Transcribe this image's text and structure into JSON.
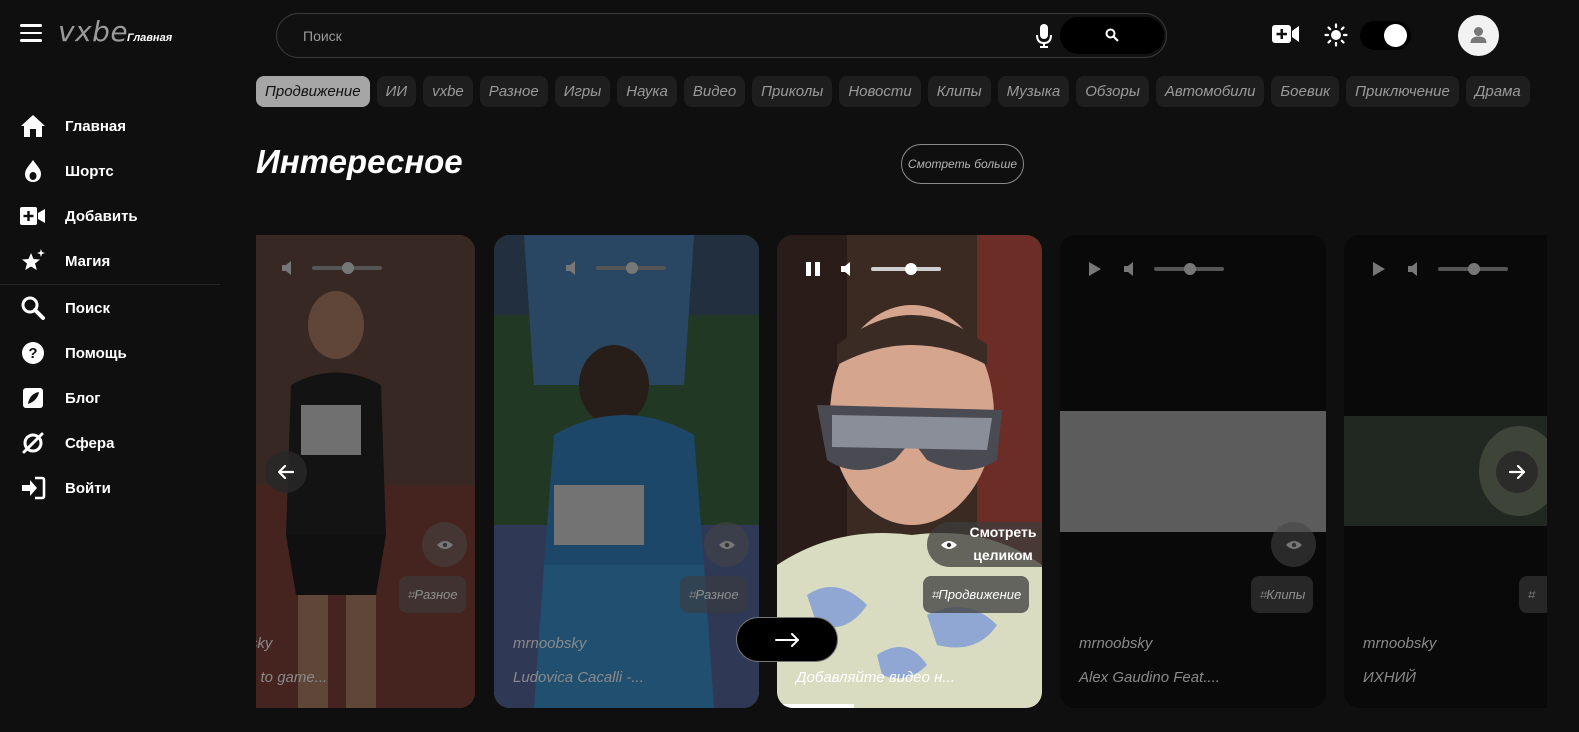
{
  "header": {
    "logo": "vxbe",
    "logo_sub": "Главная",
    "search_placeholder": "Поиск"
  },
  "sidebar": {
    "items": [
      {
        "label": "Главная",
        "icon": "home-icon"
      },
      {
        "label": "Шортс",
        "icon": "flame-icon"
      },
      {
        "label": "Добавить",
        "icon": "add-video-icon"
      },
      {
        "label": "Магия",
        "icon": "magic-star-icon"
      },
      {
        "label": "Поиск",
        "icon": "search-icon"
      },
      {
        "label": "Помощь",
        "icon": "help-icon"
      },
      {
        "label": "Блог",
        "icon": "blog-icon"
      },
      {
        "label": "Сфера",
        "icon": "sphere-icon"
      },
      {
        "label": "Войти",
        "icon": "login-icon"
      }
    ]
  },
  "chips": [
    "Продвижение",
    "ИИ",
    "vxbe",
    "Разное",
    "Игры",
    "Наука",
    "Видео",
    "Приколы",
    "Новости",
    "Клипы",
    "Музыка",
    "Обзоры",
    "Автомобили",
    "Боевик",
    "Приключение",
    "Драма"
  ],
  "active_chip": "Продвижение",
  "section": {
    "title": "Интересное",
    "see_more": "Смотреть больше"
  },
  "cards": [
    {
      "author": "mrnoobsky",
      "caption": "m cutie to game...",
      "tag": "Разное"
    },
    {
      "author": "mrnoobsky",
      "caption": "Ludovica Cacalli -...",
      "tag": "Разное"
    },
    {
      "author": "",
      "caption": "Добавляйте видео н...",
      "tag": "Продвижение",
      "watch_full": "Смотреть целиком"
    },
    {
      "author": "mrnoobsky",
      "caption": "Alex Gaudino Feat....",
      "tag": "Клипы"
    },
    {
      "author": "mrnoobsky",
      "caption": "ИХНИЙ",
      "tag": ""
    }
  ],
  "colors": {
    "background": "#0f0f0f",
    "chip_bg": "#1e1e1e",
    "chip_active_bg": "#a6a6a6",
    "text": "#ffffff",
    "muted": "#9a9a9a"
  }
}
